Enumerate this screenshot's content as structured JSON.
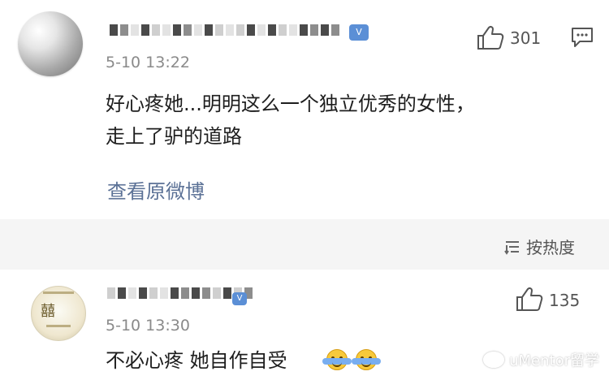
{
  "comments": [
    {
      "time": "5-10 13:22",
      "text": [
        "好心疼她...明明这么一个独立优秀的女性，",
        "走上了驴的道路"
      ],
      "likes": "301",
      "link": "查看原微博",
      "icons": {
        "like": "thumb-up-icon",
        "reply": "comment-icon"
      }
    },
    {
      "time": "5-10 13:30",
      "text": "不必心疼 她自作自受",
      "likes": "135",
      "icons": {
        "like": "thumb-up-icon",
        "emoji": "hug-emoji-icon"
      }
    }
  ],
  "sort": {
    "label": "按热度",
    "icon": "sort-icon"
  },
  "watermark": {
    "text": "uMentor留学",
    "icon": "weibo-logo-icon"
  },
  "colors": {
    "link": "#5b7196",
    "time": "#8a8a8a",
    "body": "#1e1e1e",
    "separator": "#f5f5f5",
    "badge": "#5b8fd6"
  }
}
